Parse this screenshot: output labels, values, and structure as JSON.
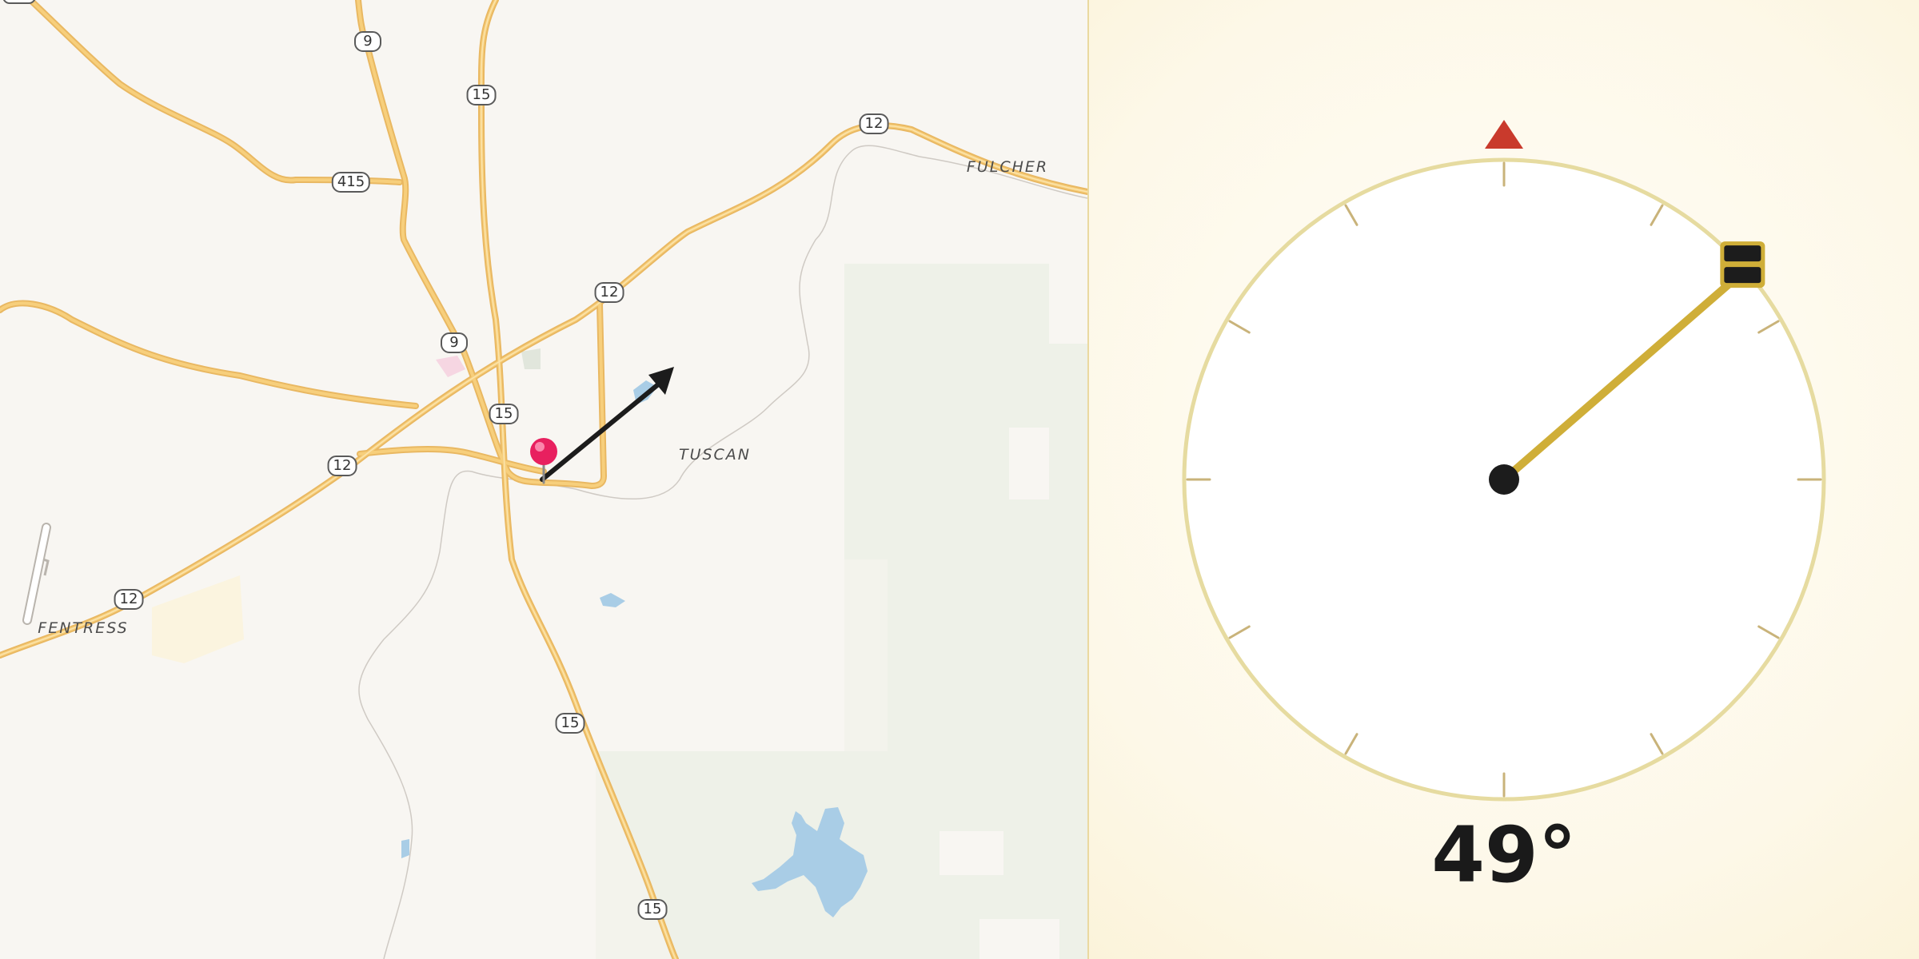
{
  "map": {
    "place_labels": {
      "fulcher": "FULCHER",
      "tuscan": "TUSCAN",
      "fentress": "FENTRESS"
    },
    "route_shields": {
      "r9_north": "9",
      "r15_north": "15",
      "r12_east": "12",
      "r415": "415",
      "r12_mid": "12",
      "r9_south": "9",
      "r15_mid": "15",
      "r12_west": "12",
      "r12_southwest": "12",
      "r15_south": "15",
      "r15_bottom": "15"
    },
    "colors": {
      "background": "#f8f6f2",
      "road": "#f7cf7c",
      "road_edge": "#e9b862",
      "water": "#a9cde6",
      "park": "#eef1e8",
      "pin": "#e8205f",
      "arrow": "#1c1c1c"
    },
    "pin_icon": "map-pin-icon",
    "direction_arrow_icon": "direction-arrow-icon"
  },
  "compass": {
    "heading_degrees": 49,
    "heading_text": "49°",
    "north_marker_icon": "north-triangle-icon",
    "needle_icon": "compass-needle-icon",
    "colors": {
      "ring": "#e6dba0",
      "tick": "#c9b37a",
      "needle": "#cfae38",
      "north_marker": "#c93a2c",
      "hub": "#1c1c1c"
    }
  }
}
